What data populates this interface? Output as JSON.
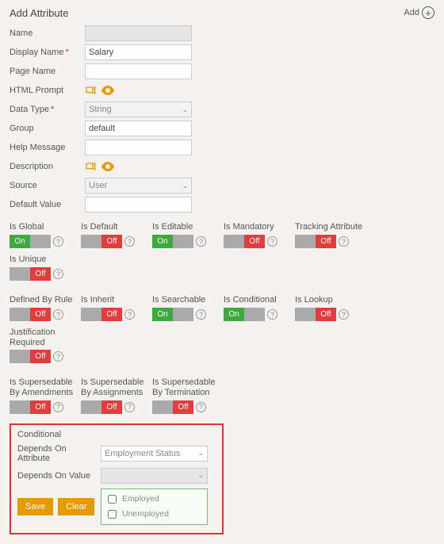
{
  "header": {
    "title": "Add  Attribute",
    "add_label": "Add"
  },
  "fields": {
    "name": {
      "label": "Name",
      "value": ""
    },
    "display_name": {
      "label": "Display Name",
      "value": "Salary"
    },
    "page_name": {
      "label": "Page Name",
      "value": ""
    },
    "html_prompt": {
      "label": "HTML Prompt"
    },
    "data_type": {
      "label": "Data Type",
      "value": "String"
    },
    "group": {
      "label": "Group",
      "value": "default"
    },
    "help_message": {
      "label": "Help Message",
      "value": ""
    },
    "description": {
      "label": "Description"
    },
    "source": {
      "label": "Source",
      "value": "User"
    },
    "default_value": {
      "label": "Default Value",
      "value": ""
    }
  },
  "toggle_text": {
    "on": "On",
    "off": "Off"
  },
  "toggles": {
    "row1": [
      {
        "label": "Is Global",
        "state": "on"
      },
      {
        "label": "Is Default",
        "state": "off"
      },
      {
        "label": "Is Editable",
        "state": "on"
      },
      {
        "label": "Is Mandatory",
        "state": "off"
      },
      {
        "label": "Tracking Attribute",
        "state": "off"
      },
      {
        "label": "Is Unique",
        "state": "off"
      }
    ],
    "row2": [
      {
        "label": "Defined By Rule",
        "state": "off"
      },
      {
        "label": "Is Inherit",
        "state": "off"
      },
      {
        "label": "Is Searchable",
        "state": "on"
      },
      {
        "label": "Is Conditional",
        "state": "on"
      },
      {
        "label": "Is Lookup",
        "state": "off"
      },
      {
        "label": "Justification Required",
        "state": "off"
      }
    ],
    "row3": [
      {
        "label": "Is Supersedable By Amendments",
        "state": "off"
      },
      {
        "label": "Is Supersedable By Assignments",
        "state": "off"
      },
      {
        "label": "Is Supersedable By Termination",
        "state": "off"
      }
    ]
  },
  "conditional": {
    "title": "Conditional",
    "depends_attr_label": "Depends On Attribute",
    "depends_attr_value": "Employment Status",
    "depends_val_label": "Depends On Value",
    "depends_val_value": "",
    "options": [
      "Employed",
      "Unemployed"
    ],
    "save_label": "Save",
    "clear_label": "Clear"
  }
}
